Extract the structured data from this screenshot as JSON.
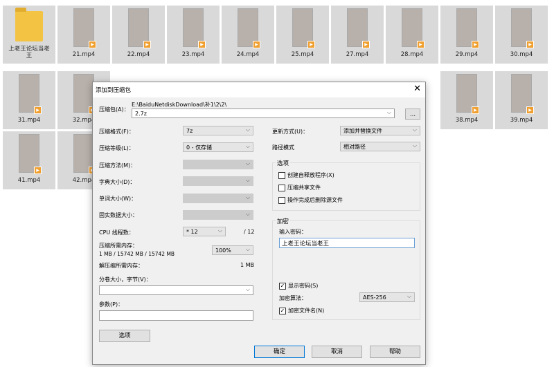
{
  "explorer": {
    "folder": {
      "label": "上老王论坛当老王"
    },
    "files": [
      {
        "row": 0,
        "col": 1,
        "name": "21.mp4"
      },
      {
        "row": 0,
        "col": 2,
        "name": "22.mp4"
      },
      {
        "row": 0,
        "col": 3,
        "name": "23.mp4"
      },
      {
        "row": 0,
        "col": 4,
        "name": "24.mp4"
      },
      {
        "row": 0,
        "col": 5,
        "name": "25.mp4"
      },
      {
        "row": 0,
        "col": 6,
        "name": "27.mp4"
      },
      {
        "row": 0,
        "col": 7,
        "name": "28.mp4"
      },
      {
        "row": 0,
        "col": 8,
        "name": "29.mp4"
      },
      {
        "row": 0,
        "col": 9,
        "name": "30.mp4"
      },
      {
        "row": 1,
        "col": 0,
        "name": "31.mp4"
      },
      {
        "row": 1,
        "col": 1,
        "name": "32.mp4"
      },
      {
        "row": 1,
        "col": 8,
        "name": "38.mp4"
      },
      {
        "row": 1,
        "col": 9,
        "name": "39.mp4"
      },
      {
        "row": 2,
        "col": 0,
        "name": "41.mp4"
      },
      {
        "row": 2,
        "col": 1,
        "name": "42.mp4"
      }
    ]
  },
  "dialog": {
    "title": "添加到压缩包",
    "archive_label": "压缩包(A)：",
    "archive_dir": "E:\\BaiduNetdiskDownload\\补1\\2\\2\\",
    "archive_name": "2.7z",
    "browse": "...",
    "format_label": "压缩格式(F)：",
    "format": "7z",
    "level_label": "压缩等级(L)：",
    "level": "0 - 仅存储",
    "method_label": "压缩方法(M)：",
    "dict_label": "字典大小(D)：",
    "word_label": "单词大小(W)：",
    "solid_label": "固实数据大小：",
    "cpu_label": "CPU 线程数：",
    "cpu": "* 12",
    "cpu_total": "/ 12",
    "mem_label": "压缩所需内存：",
    "mem_value": "1 MB / 15742 MB / 15742 MB",
    "mem_pct": "100%",
    "demem_label": "解压缩所需内存：",
    "demem_value": "1 MB",
    "split_label": "分卷大小，字节(V)：",
    "params_label": "参数(P)：",
    "options_btn": "选项",
    "update_label": "更新方式(U)：",
    "update": "添加并替换文件",
    "path_label": "路径模式",
    "path": "相对路径",
    "options_group": "选项",
    "opt_sfx": "创建自释放程序(X)",
    "opt_shared": "压缩共享文件",
    "opt_delete": "操作完成后删除源文件",
    "enc_group": "加密",
    "pwd_label": "输入密码：",
    "pwd": "上老王论坛当老王",
    "show_pwd": "显示密码(S)",
    "enc_method_label": "加密算法：",
    "enc_method": "AES-256",
    "enc_names": "加密文件名(N)",
    "ok": "确定",
    "cancel": "取消",
    "help": "帮助"
  }
}
